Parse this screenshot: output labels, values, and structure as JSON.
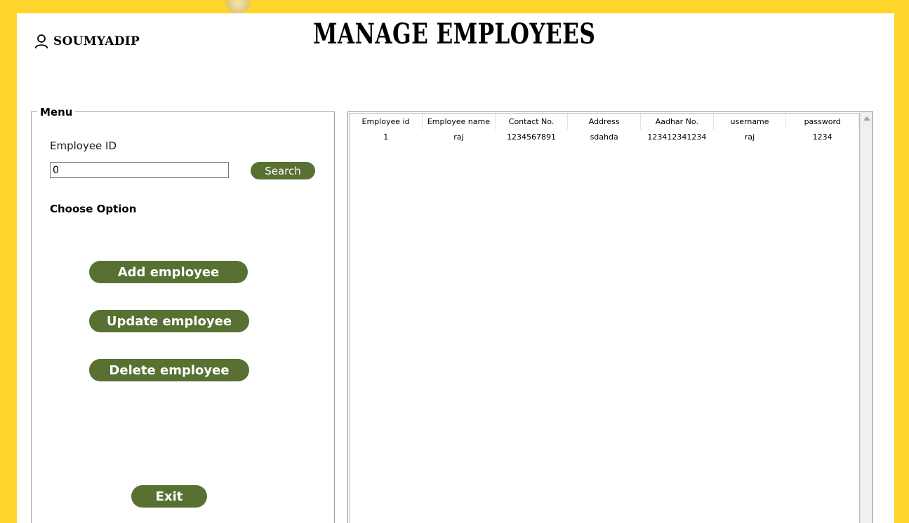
{
  "header": {
    "username": "SOUMYADIP",
    "title": "MANAGE EMPLOYEES"
  },
  "menu": {
    "legend": "Menu",
    "employee_id_label": "Employee ID",
    "employee_id_value": "0",
    "search_label": "Search",
    "choose_option_label": "Choose Option",
    "add_label": "Add employee",
    "update_label": "Update employee",
    "delete_label": "Delete employee",
    "exit_label": "Exit"
  },
  "table": {
    "columns": [
      "Employee id",
      "Employee name",
      "Contact No.",
      "Address",
      "Aadhar No.",
      "username",
      "password"
    ],
    "rows": [
      [
        "1",
        "raj",
        "1234567891",
        "sdahda",
        "123412341234",
        "raj",
        "1234"
      ]
    ]
  },
  "colors": {
    "background": "#FFD52B",
    "button": "#587132",
    "button_text": "#ffffff"
  },
  "icons": {
    "user": "user-icon",
    "scroll_up": "scroll-up-arrow-icon",
    "scroll_down": "scroll-down-arrow-icon"
  }
}
